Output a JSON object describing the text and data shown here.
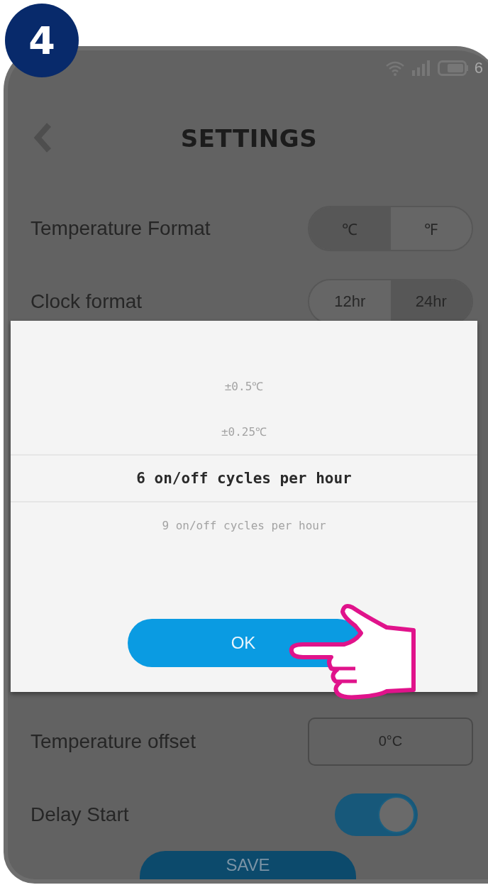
{
  "step_badge": "4",
  "status_bar": {
    "battery_text": "6"
  },
  "header": {
    "title": "SETTINGS"
  },
  "settings_top": [
    {
      "label": "Temperature Format",
      "kind": "segmented",
      "options": [
        {
          "label": "℃",
          "selected": true
        },
        {
          "label": "℉",
          "selected": false
        }
      ]
    },
    {
      "label": "Clock format",
      "kind": "segmented",
      "options": [
        {
          "label": "12hr",
          "selected": false
        },
        {
          "label": "24hr",
          "selected": true
        }
      ]
    }
  ],
  "picker": {
    "options": [
      {
        "label": "±0.5℃",
        "selected": false
      },
      {
        "label": "±0.25℃",
        "selected": false
      },
      {
        "label": "6 on/off cycles per hour",
        "selected": true
      },
      {
        "label": "9 on/off cycles per hour",
        "selected": false
      }
    ],
    "button": "OK"
  },
  "settings_bottom": [
    {
      "label": "Temperature offset",
      "kind": "field",
      "value": "0°C"
    },
    {
      "label": "Delay Start",
      "kind": "toggle",
      "on": true
    }
  ],
  "save_button": "SAVE"
}
